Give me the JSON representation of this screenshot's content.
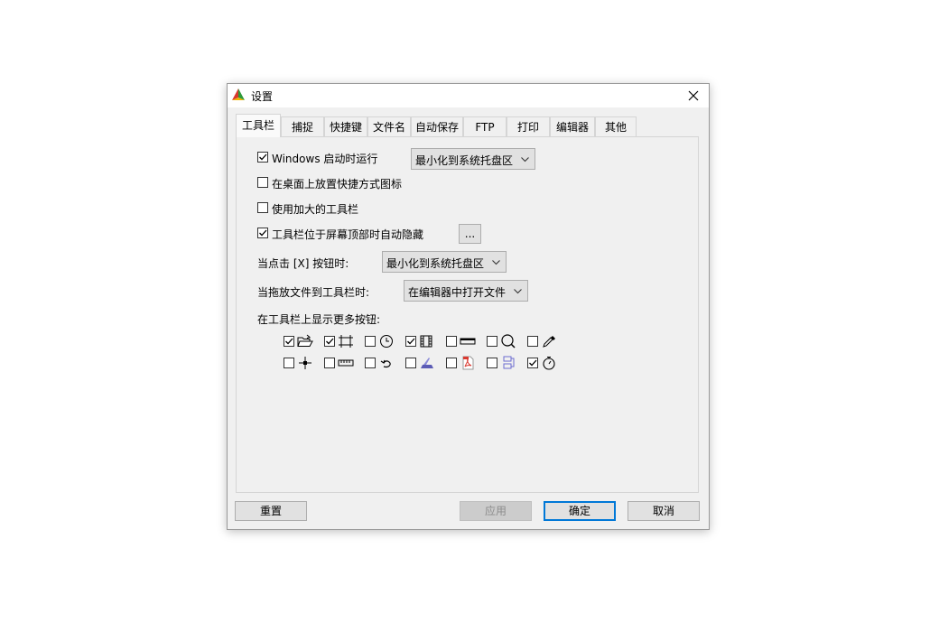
{
  "window": {
    "title": "设置"
  },
  "tabs": [
    "工具栏",
    "捕捉",
    "快捷键",
    "文件名",
    "自动保存",
    "FTP",
    "打印",
    "编辑器",
    "其他"
  ],
  "options": {
    "windows_start": {
      "label": "Windows 启动时运行",
      "checked": true
    },
    "windows_start_action": "最小化到系统托盘区",
    "desktop_shortcut": {
      "label": "在桌面上放置快捷方式图标",
      "checked": false
    },
    "large_toolbar": {
      "label": "使用加大的工具栏",
      "checked": false
    },
    "autohide": {
      "label": "工具栏位于屏幕顶部时自动隐藏",
      "checked": true
    },
    "autohide_more_button": "...",
    "close_label": "当点击 [X] 按钮时:",
    "close_action": "最小化到系统托盘区",
    "drop_label": "当拖放文件到工具栏时:",
    "drop_action": "在编辑器中打开文件",
    "more_buttons_label": "在工具栏上显示更多按钮:"
  },
  "toolbar_buttons": [
    {
      "icon": "open-folder-icon",
      "checked": true
    },
    {
      "icon": "region-capture-icon",
      "checked": true
    },
    {
      "icon": "clock-icon",
      "checked": false
    },
    {
      "icon": "film-strip-icon",
      "checked": true
    },
    {
      "icon": "scrolling-window-icon",
      "checked": false
    },
    {
      "icon": "magnifier-icon",
      "checked": false
    },
    {
      "icon": "color-picker-icon",
      "checked": false
    },
    {
      "icon": "crosshair-icon",
      "checked": false
    },
    {
      "icon": "ruler-icon",
      "checked": false
    },
    {
      "icon": "undo-arrow-icon",
      "checked": false
    },
    {
      "icon": "scanner-icon",
      "checked": false
    },
    {
      "icon": "pdf-icon",
      "checked": false
    },
    {
      "icon": "compare-icon",
      "checked": false
    },
    {
      "icon": "stopwatch-icon",
      "checked": true
    }
  ],
  "buttons": {
    "reset": "重置",
    "apply": "应用",
    "ok": "确定",
    "cancel": "取消"
  },
  "colors": {
    "accent": "#0078d7",
    "dialog_bg": "#f0f0f0"
  }
}
